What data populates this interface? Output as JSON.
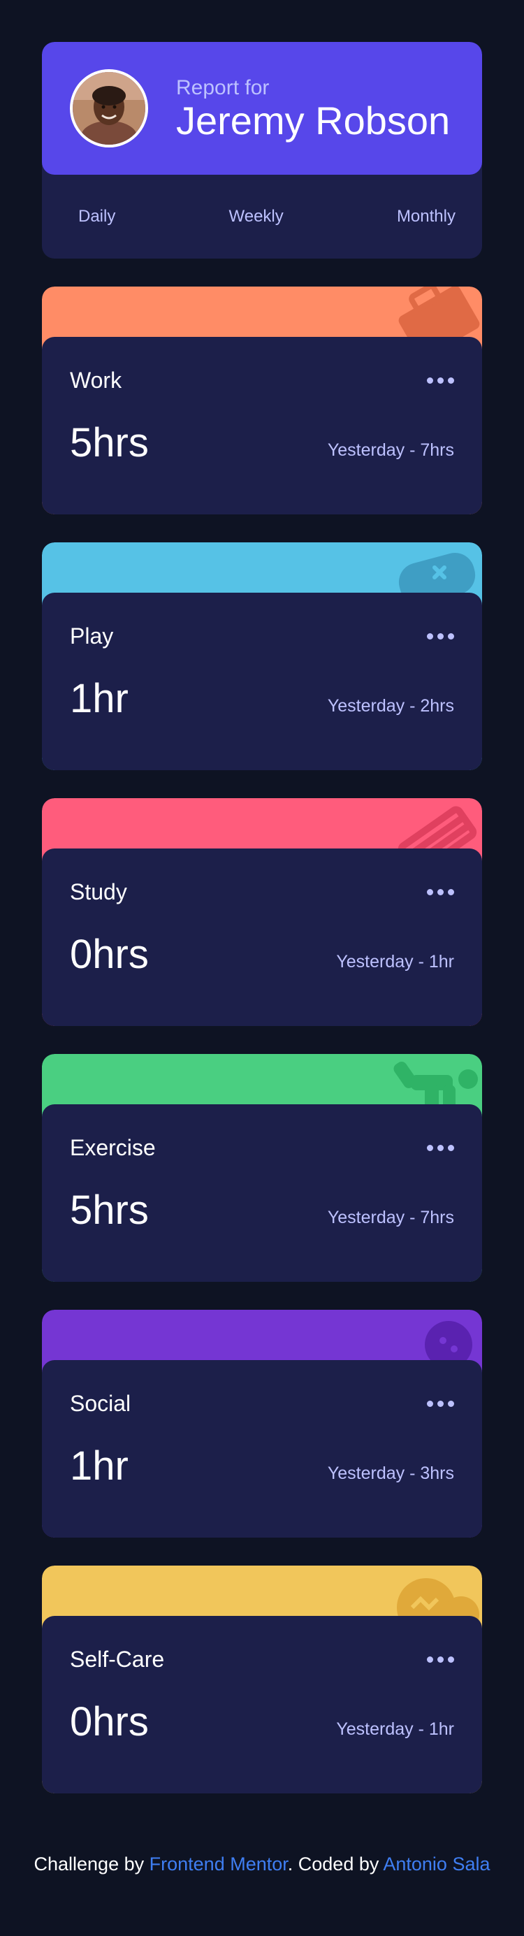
{
  "profile": {
    "pre_label": "Report for",
    "name": "Jeremy Robson",
    "periods": [
      "Daily",
      "Weekly",
      "Monthly"
    ]
  },
  "cards": [
    {
      "title": "Work",
      "hours": "5hrs",
      "previous": "Yesterday - 7hrs",
      "color": "#ff8c66",
      "icon": "briefcase-icon"
    },
    {
      "title": "Play",
      "hours": "1hr",
      "previous": "Yesterday - 2hrs",
      "color": "#56c2e6",
      "icon": "gamepad-icon"
    },
    {
      "title": "Study",
      "hours": "0hrs",
      "previous": "Yesterday - 1hr",
      "color": "#ff5c7c",
      "icon": "book-icon"
    },
    {
      "title": "Exercise",
      "hours": "5hrs",
      "previous": "Yesterday - 7hrs",
      "color": "#4acf81",
      "icon": "running-icon"
    },
    {
      "title": "Social",
      "hours": "1hr",
      "previous": "Yesterday - 3hrs",
      "color": "#7536d3",
      "icon": "chat-icon"
    },
    {
      "title": "Self-Care",
      "hours": "0hrs",
      "previous": "Yesterday - 1hr",
      "color": "#f1c65b",
      "icon": "heart-icon"
    }
  ],
  "footer": {
    "prefix": "Challenge by",
    "link1": "Frontend Mentor",
    "middle": ".  Coded by",
    "link2": "Antonio Sala"
  },
  "colors": {
    "background": "#0e1323",
    "card": "#1c1f4a",
    "profile": "#5747ea",
    "muted": "#bdc1ff",
    "link": "#3f7ef2"
  }
}
